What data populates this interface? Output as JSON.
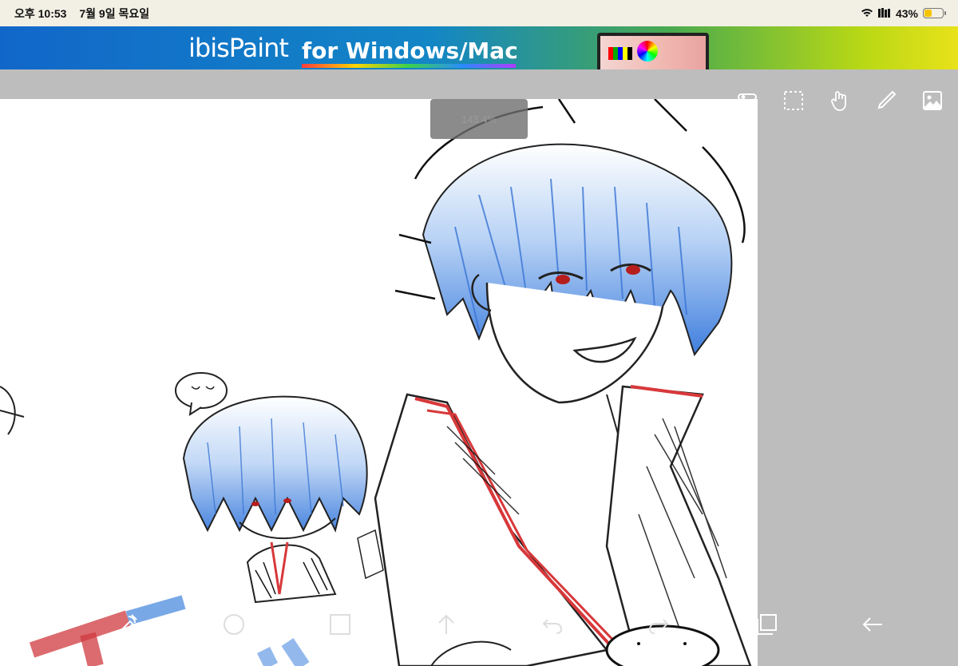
{
  "status_bar": {
    "time": "오후 10:53",
    "date": "7월 9일 목요일",
    "battery_percent": "43%",
    "battery_level": 0.43,
    "icons": [
      "wifi-icon",
      "library-icon"
    ]
  },
  "ad_banner": {
    "logo_text": "ibisPaint",
    "tagline": "for Windows/Mac"
  },
  "canvas": {
    "zoom_label": "143.4%"
  },
  "top_tools": [
    "toggle-icon",
    "selection-icon",
    "hand-icon",
    "brush-icon",
    "image-icon"
  ],
  "bottom_tools": [
    "transform-icon",
    "circle-icon",
    "square-icon",
    "arrow-up-icon",
    "undo-icon",
    "redo-icon",
    "layers-icon",
    "back-arrow-icon"
  ],
  "colors": {
    "canvas_bg": "#ffffff",
    "workspace_bg": "#bdbdbd",
    "status_bg": "#f2f0e4",
    "battery": "#f5c400",
    "sketch_blue": "#4d8be0",
    "sketch_red": "#d8383a"
  }
}
